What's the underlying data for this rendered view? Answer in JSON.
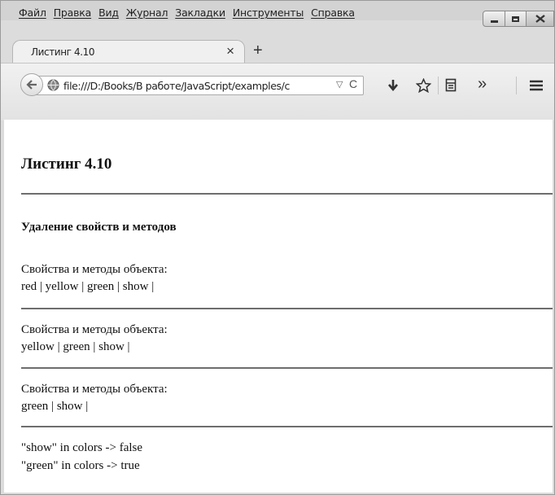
{
  "menu": [
    "Файл",
    "Правка",
    "Вид",
    "Журнал",
    "Закладки",
    "Инструменты",
    "Справка"
  ],
  "tab": {
    "title": "Листинг 4.10",
    "close": "×",
    "new": "+"
  },
  "address": {
    "url": "file:///D:/Books/В работе/JavaScript/examples/c"
  },
  "page": {
    "heading": "Листинг 4.10",
    "subheading": "Удаление свойств и методов",
    "blocks": [
      {
        "label": "Свойства и методы объекта:",
        "items": "red | yellow | green | show |"
      },
      {
        "label": "Свойства и методы объекта:",
        "items": "yellow | green | show |"
      },
      {
        "label": "Свойства и методы объекта:",
        "items": "green | show |"
      }
    ],
    "checks": [
      "\"show\" in colors -> false",
      "\"green\" in colors -> true"
    ]
  },
  "colors": {
    "window": "#dcdcdc",
    "content": "#ffffff",
    "rule": "#6e6e6e"
  },
  "icons": [
    "back-arrow-icon",
    "globe-icon",
    "reload-icon",
    "download-icon",
    "bookmark-star-icon",
    "reading-list-icon",
    "overflow-chevron-icon",
    "hamburger-menu-icon"
  ]
}
